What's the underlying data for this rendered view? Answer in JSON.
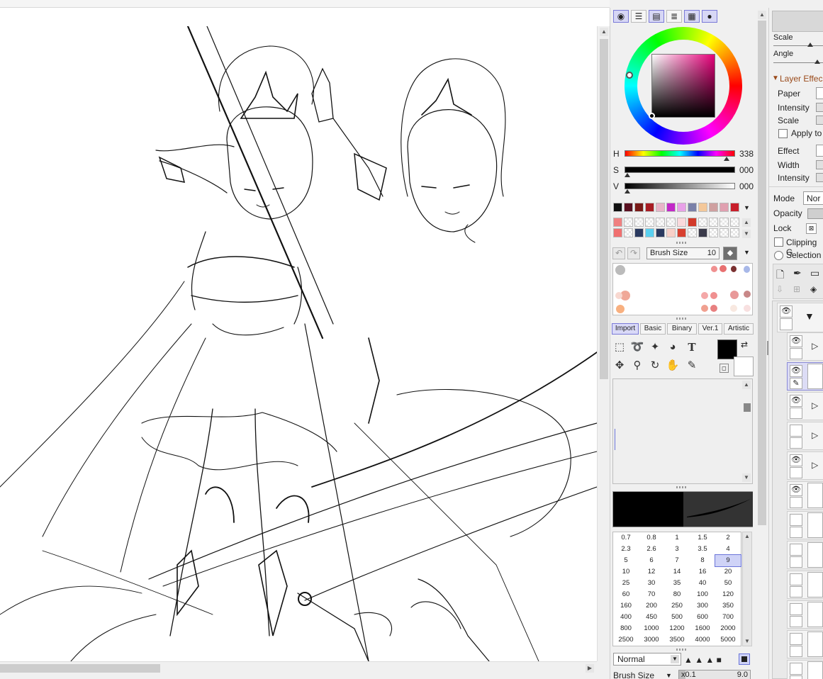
{
  "window": {
    "app": "PaintTool SAI"
  },
  "color_panel": {
    "mode_tabs": [
      "color-wheel",
      "rgb-sliders",
      "hsv-sliders",
      "swatches-list",
      "palette-grid",
      "scratchpad"
    ],
    "hsv": {
      "h_label": "H",
      "h_value": "338",
      "s_label": "S",
      "s_value": "000",
      "v_label": "V",
      "v_value": "000"
    },
    "palette_row1": [
      "#111111",
      "#5a1020",
      "#7a1a18",
      "#a81c24",
      "#e8b4c8",
      "#c228c8",
      "#e8a0e8",
      "#7a80a8",
      "#f4c89a",
      "#cfa0a0",
      "#e0a0b0",
      "#c81e2a"
    ],
    "palette_row2": [
      "#f08080",
      "#ffffff",
      "#ffffff",
      "#ffffff",
      "#ffffff",
      "#ffffff",
      "#fadadd",
      "#d23a2a",
      "#ffffff",
      "#ffffff",
      "#ffffff",
      "#ffffff"
    ],
    "palette_row3": [
      "#f07070",
      "#ffffff",
      "#2a3a60",
      "#5ad0f0",
      "#2a3a60",
      "#f8d0c8",
      "#d84030",
      "#ffffff",
      "#3a3a4a",
      "#ffffff",
      "#ffffff",
      "#ffffff"
    ]
  },
  "brush_bar": {
    "label": "Brush Size",
    "value": "10"
  },
  "tool_modes": [
    "Import",
    "Basic",
    "Binary",
    "Ver.1",
    "Artistic"
  ],
  "tool_modes_selected": "Import",
  "sizes": [
    [
      "0.7",
      "0.8",
      "1",
      "1.5",
      "2"
    ],
    [
      "2.3",
      "2.6",
      "3",
      "3.5",
      "4"
    ],
    [
      "5",
      "6",
      "7",
      "8",
      "9"
    ],
    [
      "10",
      "12",
      "14",
      "16",
      "20"
    ],
    [
      "25",
      "30",
      "35",
      "40",
      "50"
    ],
    [
      "60",
      "70",
      "80",
      "100",
      "120"
    ],
    [
      "160",
      "200",
      "250",
      "300",
      "350"
    ],
    [
      "400",
      "450",
      "500",
      "600",
      "700"
    ],
    [
      "800",
      "1000",
      "1200",
      "1600",
      "2000"
    ],
    [
      "2500",
      "3000",
      "3500",
      "4000",
      "5000"
    ]
  ],
  "selected_size": "9",
  "blend": {
    "mode": "Normal"
  },
  "brush_size_row": {
    "label": "Brush Size",
    "mult": "x0.1",
    "value": "9.0"
  },
  "layer_panel": {
    "scale_label": "Scale",
    "angle_label": "Angle",
    "layer_effects": "Layer Effec",
    "paper": "Paper",
    "intensity": "Intensity",
    "scale2": "Scale",
    "apply_to": "Apply to",
    "effect": "Effect",
    "width": "Width",
    "intensity2": "Intensity",
    "mode_label": "Mode",
    "mode_value": "Nor",
    "opacity_label": "Opacity",
    "lock_label": "Lock",
    "clipping": "Clipping G",
    "selection": "Selection"
  }
}
